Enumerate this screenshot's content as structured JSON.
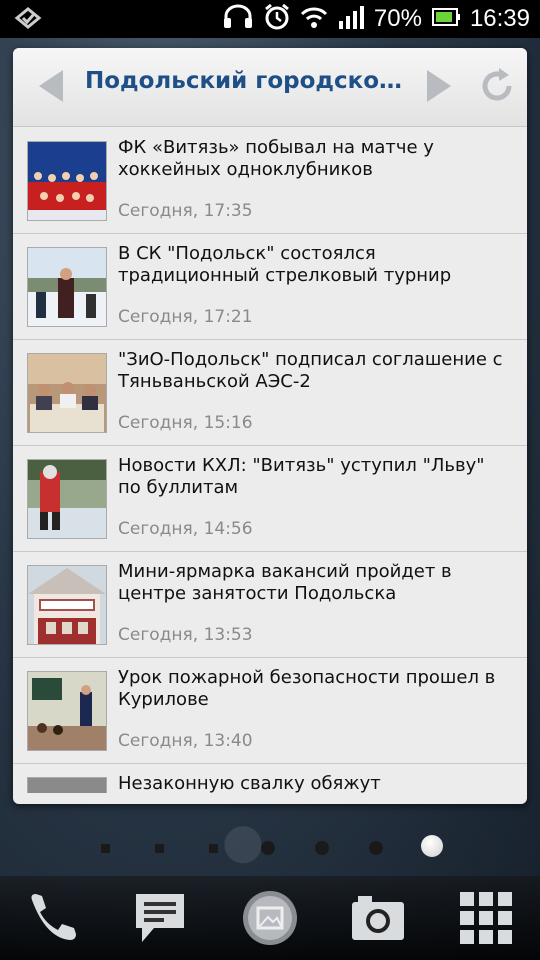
{
  "status_bar": {
    "battery_percent": "70%",
    "time": "16:39"
  },
  "widget": {
    "title": "Подольский городской п...",
    "items": [
      {
        "title": "ФК «Витязь» побывал на матче у хоккейных одноклубников",
        "time": "Сегодня, 17:35"
      },
      {
        "title": "В СК \"Подольск\" состоялся традиционный стрелковый турнир",
        "time": "Сегодня, 17:21"
      },
      {
        "title": "\"ЗиО-Подольск\" подписал соглашение с Тяньваньской АЭС-2",
        "time": "Сегодня, 15:16"
      },
      {
        "title": "Новости КХЛ: \"Витязь\" уступил \"Льву\" по буллитам",
        "time": "Сегодня, 14:56"
      },
      {
        "title": "Мини-ярмарка вакансий пройдет в центре занятости Подольска",
        "time": "Сегодня, 13:53"
      },
      {
        "title": "Урок пожарной безопасности прошел в Курилове",
        "time": "Сегодня, 13:40"
      },
      {
        "title": "Незаконную свалку обяжут",
        "time": ""
      }
    ]
  },
  "dock": {
    "icons": [
      "phone-icon",
      "messages-icon",
      "gallery-icon",
      "camera-icon",
      "apps-grid-icon"
    ]
  }
}
